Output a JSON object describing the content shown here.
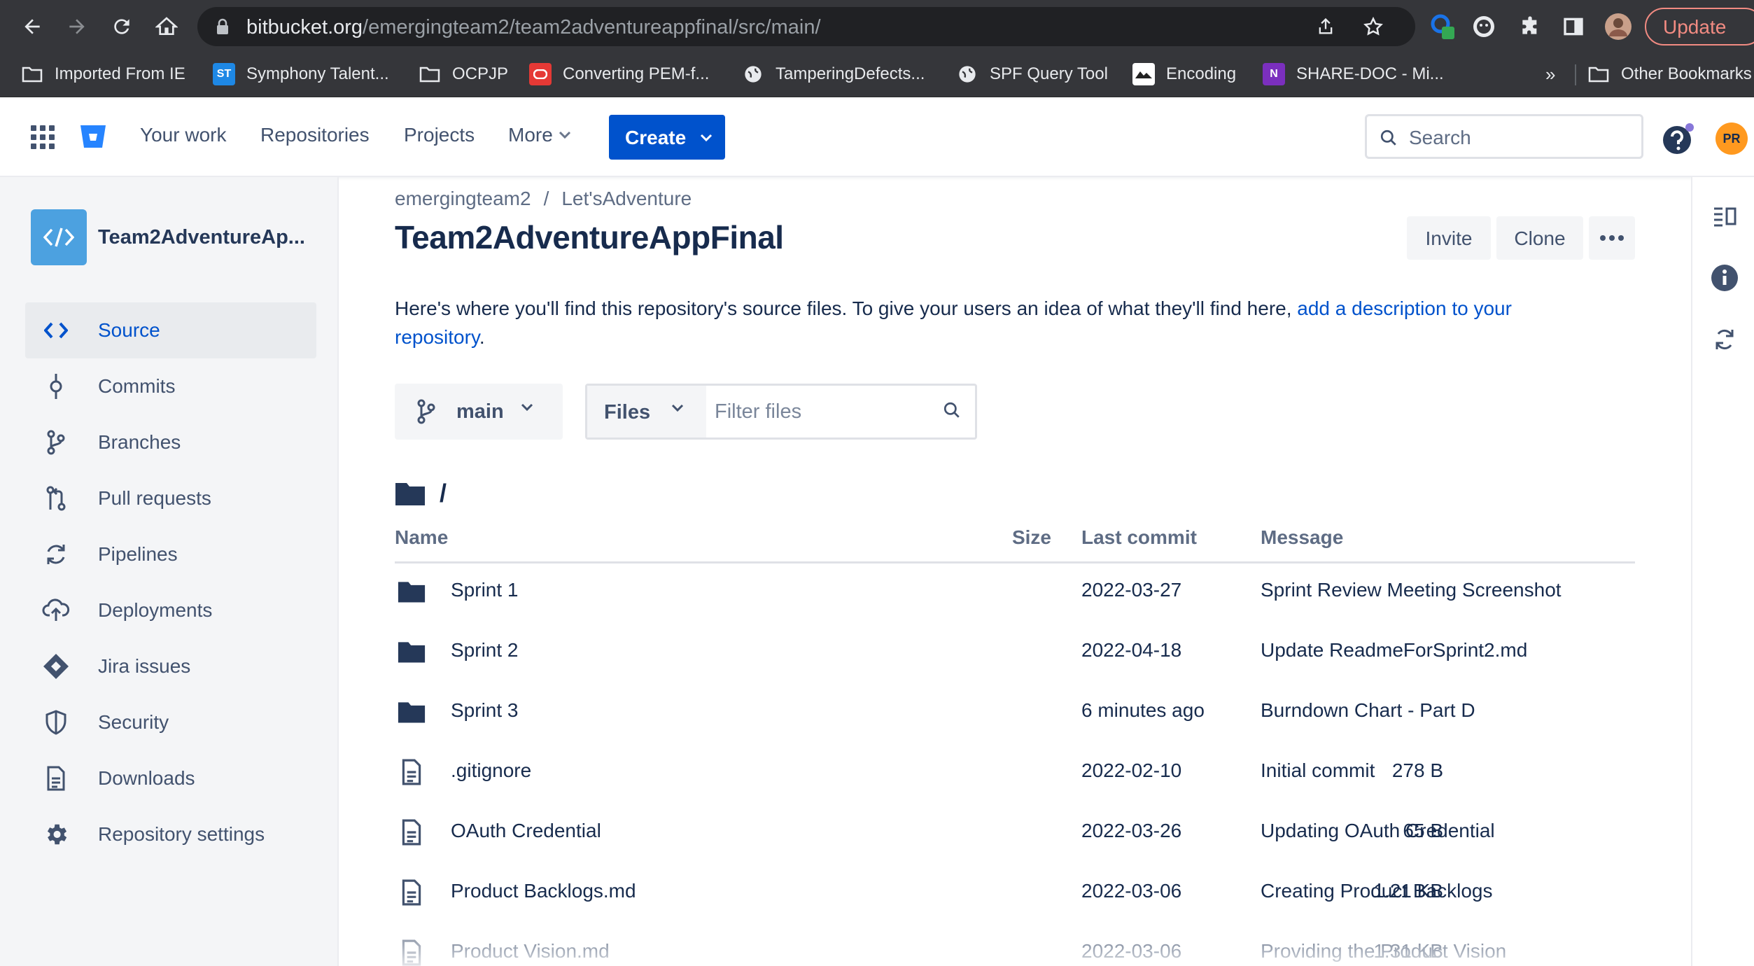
{
  "browser": {
    "url_host": "bitbucket.org",
    "url_path": "/emergingteam2/team2adventureappfinal/src/main/",
    "update_label": "Update",
    "bookmarks": [
      {
        "label": "Imported From IE",
        "icon": "folder-icon"
      },
      {
        "label": "Symphony Talent...",
        "icon": "symphony-talent-icon",
        "icon_text": "ST"
      },
      {
        "label": "OCPJP",
        "icon": "folder-icon"
      },
      {
        "label": "Converting PEM-f...",
        "icon": "converting-pem-icon"
      },
      {
        "label": "TamperingDefects...",
        "icon": "globe-icon"
      },
      {
        "label": "SPF Query Tool",
        "icon": "globe-icon"
      },
      {
        "label": "Encoding",
        "icon": "encoding-icon"
      },
      {
        "label": "SHARE-DOC - Mi...",
        "icon": "onenote-icon",
        "icon_text": "N"
      }
    ],
    "bookmarks_overflow": "»",
    "other_bookmarks": "Other Bookmarks"
  },
  "header": {
    "nav": [
      "Your work",
      "Repositories",
      "Projects",
      "More"
    ],
    "create_label": "Create",
    "search_placeholder": "Search",
    "avatar_initials": "PR"
  },
  "sidebar": {
    "repo_name": "Team2AdventureAp...",
    "items": [
      {
        "label": "Source",
        "icon": "code-icon",
        "active": true
      },
      {
        "label": "Commits",
        "icon": "commit-icon"
      },
      {
        "label": "Branches",
        "icon": "branch-icon"
      },
      {
        "label": "Pull requests",
        "icon": "pull-request-icon"
      },
      {
        "label": "Pipelines",
        "icon": "pipelines-icon"
      },
      {
        "label": "Deployments",
        "icon": "deployments-icon"
      },
      {
        "label": "Jira issues",
        "icon": "jira-icon"
      },
      {
        "label": "Security",
        "icon": "shield-icon"
      },
      {
        "label": "Downloads",
        "icon": "downloads-icon"
      },
      {
        "label": "Repository settings",
        "icon": "gear-icon"
      }
    ]
  },
  "main": {
    "breadcrumb": [
      "emergingteam2",
      "Let'sAdventure"
    ],
    "breadcrumb_sep": "/",
    "title": "Team2AdventureAppFinal",
    "invite_label": "Invite",
    "clone_label": "Clone",
    "description_text": "Here's where you'll find this repository's source files. To give your users an idea of what they'll find here, ",
    "description_link": "add a description to your repository",
    "description_end": ".",
    "branch": "main",
    "files_select": "Files",
    "filter_placeholder": "Filter files",
    "path": "/",
    "columns": {
      "name": "Name",
      "size": "Size",
      "last_commit": "Last commit",
      "message": "Message"
    },
    "rows": [
      {
        "type": "folder",
        "name": "Sprint 1",
        "size": "",
        "date": "2022-03-27",
        "message": "Sprint Review Meeting Screenshot"
      },
      {
        "type": "folder",
        "name": "Sprint 2",
        "size": "",
        "date": "2022-04-18",
        "message": "Update ReadmeForSprint2.md"
      },
      {
        "type": "folder",
        "name": "Sprint 3",
        "size": "",
        "date": "6 minutes ago",
        "message": "Burndown Chart - Part D"
      },
      {
        "type": "file",
        "name": ".gitignore",
        "size": "278 B",
        "date": "2022-02-10",
        "message": "Initial commit"
      },
      {
        "type": "file",
        "name": "OAuth Credential",
        "size": "65 B",
        "date": "2022-03-26",
        "message": "Updating OAuth Credential"
      },
      {
        "type": "file",
        "name": "Product Backlogs.md",
        "size": "1.21 KB",
        "date": "2022-03-06",
        "message": "Creating Product Backlogs"
      },
      {
        "type": "file",
        "name": "Product Vision.md",
        "size": "1.31 KB",
        "date": "2022-03-06",
        "message": "Providing the Product Vision"
      }
    ]
  },
  "colors": {
    "brand": "#0052cc",
    "folder": "#253858",
    "chrome": "#35363a"
  }
}
